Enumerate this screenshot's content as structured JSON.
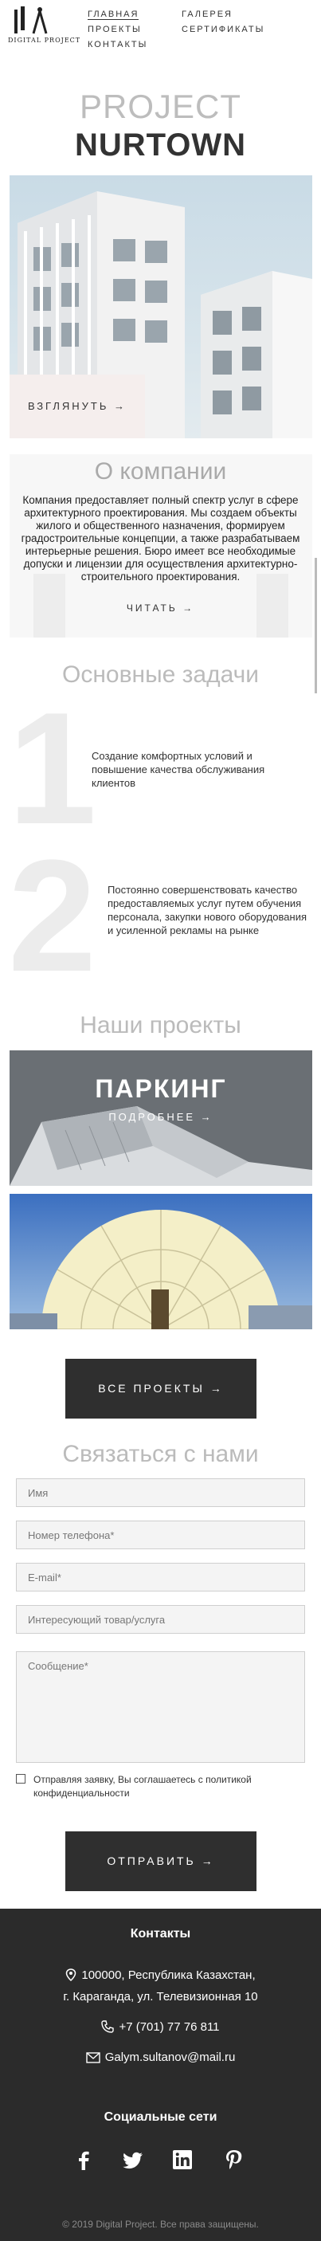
{
  "header": {
    "logo_text": "DIGITAL PROJECT",
    "nav": [
      {
        "label": "ГЛАВНАЯ",
        "active": true
      },
      {
        "label": "ГАЛЕРЕЯ",
        "active": false
      },
      {
        "label": "ПРОЕКТЫ",
        "active": false
      },
      {
        "label": "СЕРТИФИКАТЫ",
        "active": false
      },
      {
        "label": "КОНТАКТЫ",
        "active": false
      }
    ]
  },
  "hero": {
    "line1": "PROJECT",
    "line2": "NURTOWN",
    "button": "ВЗГЛЯНУТЬ →"
  },
  "about": {
    "title": "О компании",
    "text": "Компания предоставляет полный спектр услуг в сфере архитектурного проектирования. Мы создаем объекты жилого и общественного назначения, формируем градостроительные концепции, а также разрабатываем интерьерные решения. Бюро имеет все необходимые допуски и лицензии для осуществления архитектурно-строительного проектирования.",
    "link": "ЧИТАТЬ →"
  },
  "tasks": {
    "title": "Основные задачи",
    "items": [
      {
        "number": "1",
        "text": "Создание комфортных условий и повышение качества обслуживания клиентов"
      },
      {
        "number": "2",
        "text": "Постоянно совершенствовать качество предоставляемых услуг путем обучения персонала, закупки нового оборудования и усиленной рекламы на рынке"
      }
    ]
  },
  "projects": {
    "title": "Наши проекты",
    "cards": [
      {
        "name": "ПАРКИНГ",
        "more": "ПОДРОБНЕЕ →"
      }
    ],
    "all_button": "ВСЕ ПРОЕКТЫ →"
  },
  "contact_form": {
    "title": "Связаться с нами",
    "fields": {
      "name": "Имя",
      "phone": "Номер телефона*",
      "email": "E-mail*",
      "product": "Интересующий товар/услуга",
      "message": "Сообщение*"
    },
    "agree": "Отправляя заявку, Вы соглашаетесь с политикой конфиденциальности",
    "submit": "ОТПРАВИТЬ →"
  },
  "footer": {
    "contacts_title": "Контакты",
    "address_line1": "100000, Республика Казахстан,",
    "address_line2": "г. Караганда, ул. Телевизионная 10",
    "phone": "+7 (701) 77 76 811",
    "email": "Galym.sultanov@mail.ru",
    "social_title": "Социальные сети",
    "social": [
      "facebook-icon",
      "twitter-icon",
      "linkedin-icon",
      "pinterest-icon"
    ],
    "copyright": "© 2019 Digital Project. Все права защищены."
  },
  "colors": {
    "dark": "#2f2f2f",
    "footer_bg": "#2b2b2b",
    "hero_button_bg": "#f5eeed"
  }
}
